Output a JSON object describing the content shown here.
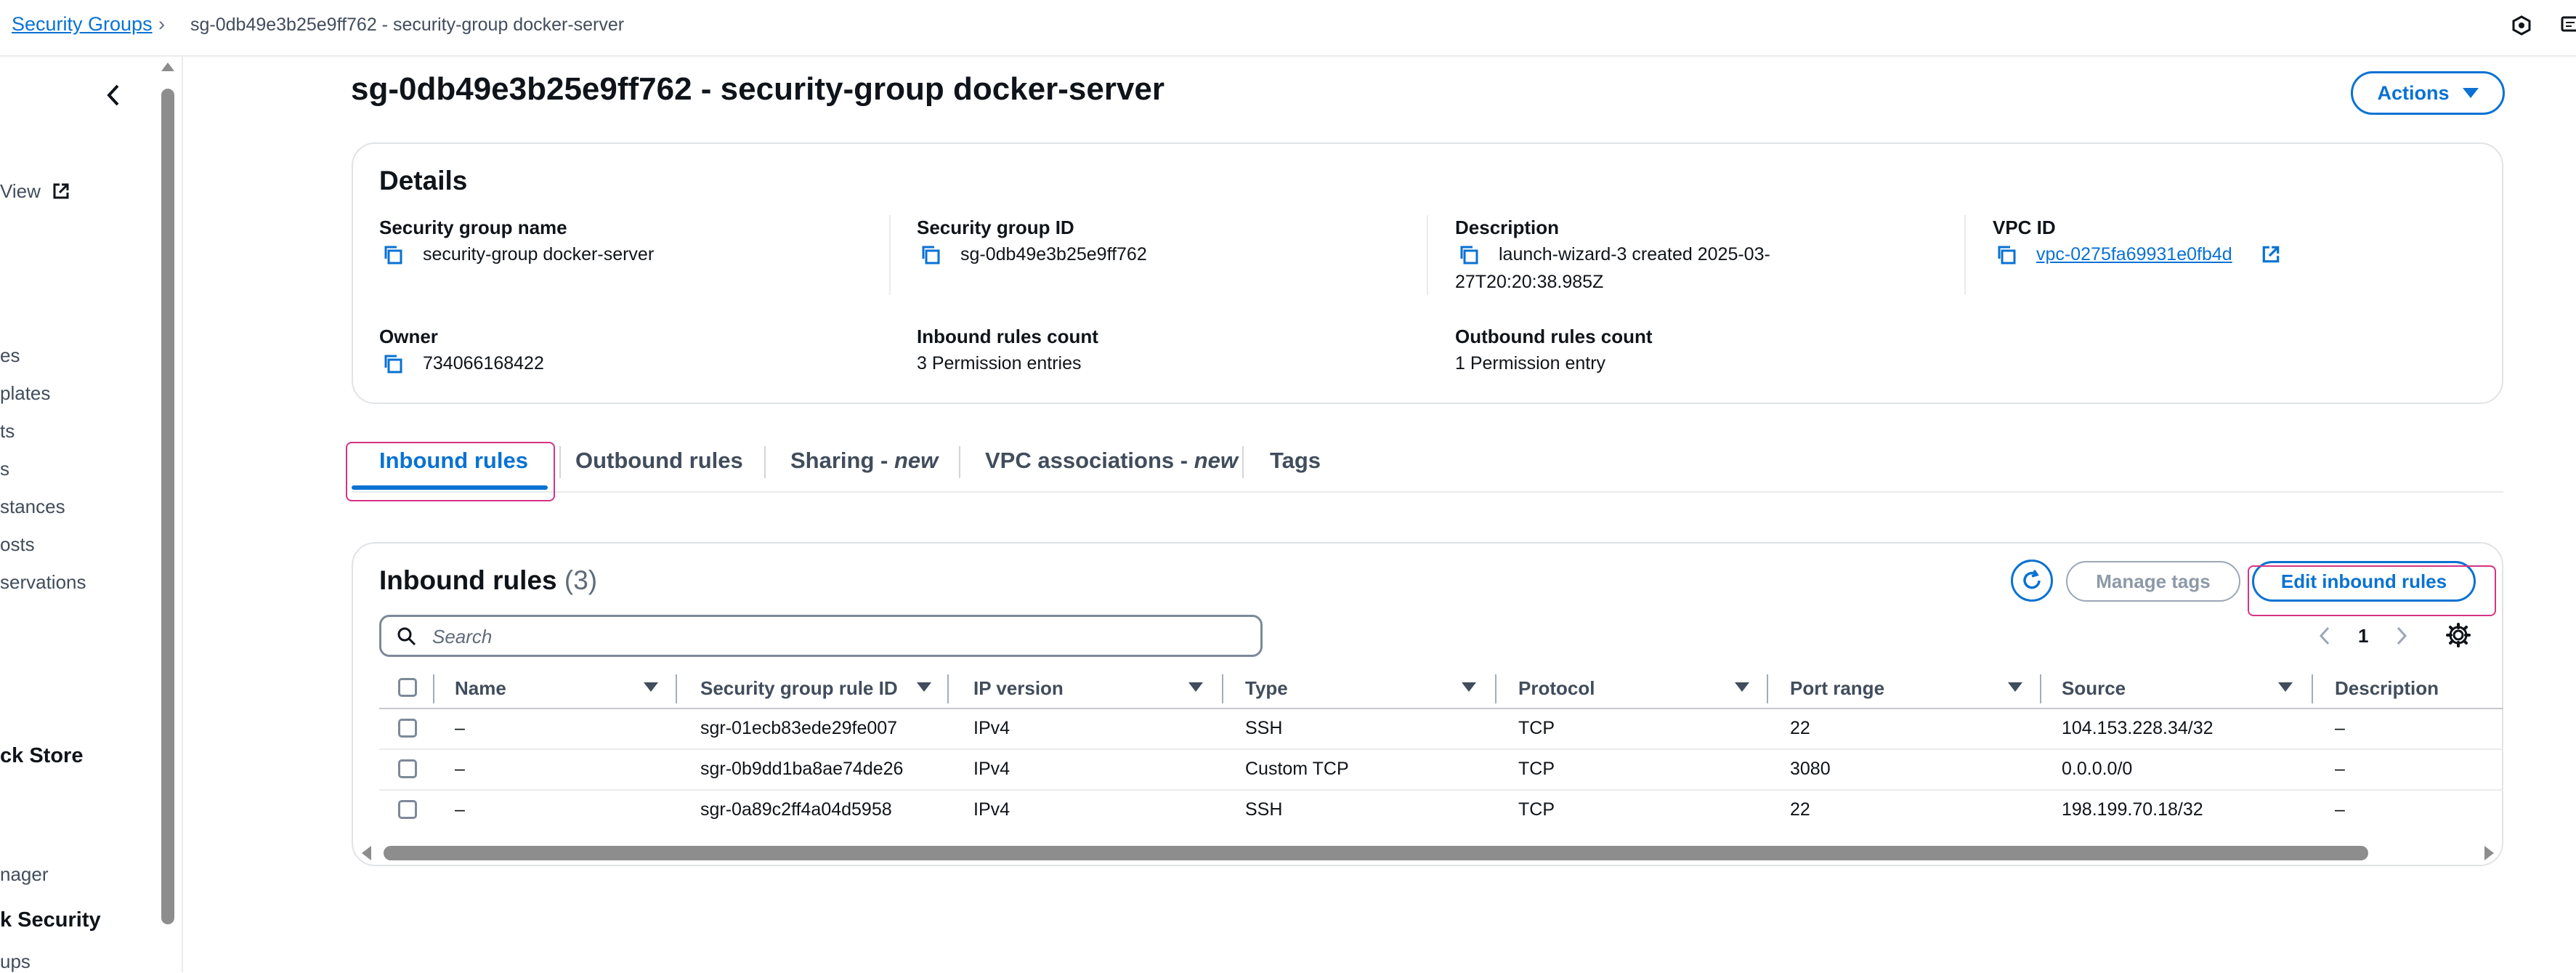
{
  "breadcrumb": {
    "parent": "Security Groups",
    "current": "sg-0db49e3b25e9ff762 - security-group docker-server"
  },
  "sidebar": {
    "items": [
      {
        "label": "View"
      },
      {
        "label": "es"
      },
      {
        "label": "plates"
      },
      {
        "label": "ts"
      },
      {
        "label": "s"
      },
      {
        "label": "stances"
      },
      {
        "label": "osts"
      },
      {
        "label": "servations"
      },
      {
        "label": "ck Store"
      },
      {
        "label": "nager"
      },
      {
        "label": "k Security"
      },
      {
        "label": "ups"
      }
    ]
  },
  "page": {
    "title": "sg-0db49e3b25e9ff762 - security-group docker-server",
    "actions_label": "Actions"
  },
  "details": {
    "title": "Details",
    "sg_name_label": "Security group name",
    "sg_name_value": "security-group docker-server",
    "sg_id_label": "Security group ID",
    "sg_id_value": "sg-0db49e3b25e9ff762",
    "description_label": "Description",
    "description_line1": "launch-wizard-3 created 2025-03-",
    "description_line2": "27T20:20:38.985Z",
    "vpc_label": "VPC ID",
    "vpc_value": "vpc-0275fa69931e0fb4d",
    "owner_label": "Owner",
    "owner_value": "734066168422",
    "inbound_count_label": "Inbound rules count",
    "inbound_count_value": "3 Permission entries",
    "outbound_count_label": "Outbound rules count",
    "outbound_count_value": "1 Permission entry"
  },
  "tabs": [
    {
      "label": "Inbound rules",
      "active": true
    },
    {
      "label": "Outbound rules"
    },
    {
      "label": "Sharing",
      "suffix": "new"
    },
    {
      "label": "VPC associations",
      "suffix": "new"
    },
    {
      "label": "Tags"
    }
  ],
  "inbound": {
    "title": "Inbound rules",
    "count": "(3)",
    "manage_tags_label": "Manage tags",
    "edit_label": "Edit inbound rules",
    "search_placeholder": "Search",
    "page": "1",
    "columns": [
      "Name",
      "Security group rule ID",
      "IP version",
      "Type",
      "Protocol",
      "Port range",
      "Source",
      "Description"
    ],
    "rows": [
      {
        "name": "–",
        "rule_id": "sgr-01ecb83ede29fe007",
        "ip": "IPv4",
        "type": "SSH",
        "protocol": "TCP",
        "port": "22",
        "source": "104.153.228.34/32",
        "description": "–"
      },
      {
        "name": "–",
        "rule_id": "sgr-0b9dd1ba8ae74de26",
        "ip": "IPv4",
        "type": "Custom TCP",
        "protocol": "TCP",
        "port": "3080",
        "source": "0.0.0.0/0",
        "description": "–"
      },
      {
        "name": "–",
        "rule_id": "sgr-0a89c2ff4a04d5958",
        "ip": "IPv4",
        "type": "SSH",
        "protocol": "TCP",
        "port": "22",
        "source": "198.199.70.18/32",
        "description": "–"
      }
    ]
  },
  "colors": {
    "accent": "#0972d3",
    "highlight": "#d63384",
    "text": "#0f141a"
  },
  "icons": [
    "chevron-right-icon",
    "settings-hex-icon",
    "feedback-icon",
    "collapse-chevron-icon",
    "external-link-icon",
    "copy-icon",
    "refresh-icon",
    "search-icon",
    "gear-icon"
  ]
}
